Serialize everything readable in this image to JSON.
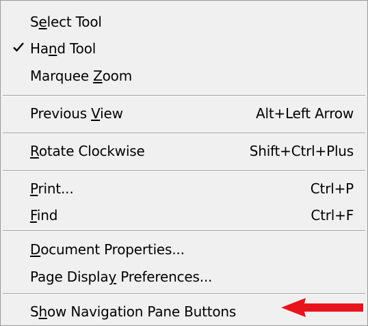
{
  "menu": {
    "items": [
      {
        "pre": "S",
        "key": "e",
        "post": "lect Tool",
        "shortcut": "",
        "checked": false
      },
      {
        "pre": "Ha",
        "key": "n",
        "post": "d Tool",
        "shortcut": "",
        "checked": true
      },
      {
        "pre": "Marquee ",
        "key": "Z",
        "post": "oom",
        "shortcut": "",
        "checked": false
      },
      {
        "pre": "Previous ",
        "key": "V",
        "post": "iew",
        "shortcut": "Alt+Left Arrow",
        "checked": false
      },
      {
        "pre": "",
        "key": "R",
        "post": "otate Clockwise",
        "shortcut": "Shift+Ctrl+Plus",
        "checked": false
      },
      {
        "pre": "",
        "key": "P",
        "post": "rint...",
        "shortcut": "Ctrl+P",
        "checked": false
      },
      {
        "pre": "",
        "key": "F",
        "post": "ind",
        "shortcut": "Ctrl+F",
        "checked": false
      },
      {
        "pre": "",
        "key": "D",
        "post": "ocument Properties...",
        "shortcut": "",
        "checked": false
      },
      {
        "pre": "Page Displa",
        "key": "y",
        "post": " Preferences...",
        "shortcut": "",
        "checked": false
      },
      {
        "pre": "S",
        "key": "h",
        "post": "ow Navigation Pane Buttons",
        "shortcut": "",
        "checked": false
      }
    ]
  },
  "colors": {
    "menu_background": "#f0f0f0",
    "separator": "#a0a0a0",
    "annotation_arrow": "#e8141c"
  },
  "icons": {
    "checkmark": "checkmark-icon",
    "annotation": "red-arrow-annotation"
  }
}
